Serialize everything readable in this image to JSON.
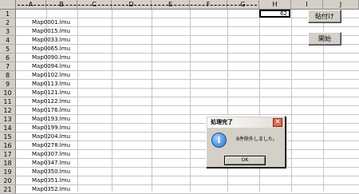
{
  "columns": [
    "A",
    "B",
    "C",
    "D",
    "E",
    "F",
    "G",
    "H",
    "I",
    "J"
  ],
  "rows": [
    "1",
    "2",
    "3",
    "4",
    "5",
    "6",
    "7",
    "8",
    "9",
    "10",
    "11",
    "12",
    "13",
    "14",
    "15",
    "16",
    "17",
    "18",
    "19",
    "20",
    "21"
  ],
  "cells": {
    "h1_value": "62",
    "b_values": [
      "",
      "Map0001.lmu",
      "Map0015.lmu",
      "Map0033.lmu",
      "Map0065.lmu",
      "Map0090.lmu",
      "Map0094.lmu",
      "Map0102.lmu",
      "Map0113.lmu",
      "Map0121.lmu",
      "Map0122.lmu",
      "Map0176.lmu",
      "Map0193.lmu",
      "Map0199.lmu",
      "Map0204.lmu",
      "Map0278.lmu",
      "Map0307.lmu",
      "Map0347.lmu",
      "Map0350.lmu",
      "Map0351.lmu",
      "Map0352.lmu"
    ]
  },
  "buttons": {
    "paste_label": "貼付け",
    "start_label": "開始"
  },
  "dialog": {
    "title": "処理完了",
    "message": "8件除外しました。",
    "ok_label": "OK",
    "close_glyph": "✕",
    "icon": "information-icon",
    "icon_glyph": "i"
  },
  "colors": {
    "header_bg": "#d4d0c8",
    "grid": "#c6c6c6",
    "close_red": "#d86a4a"
  }
}
